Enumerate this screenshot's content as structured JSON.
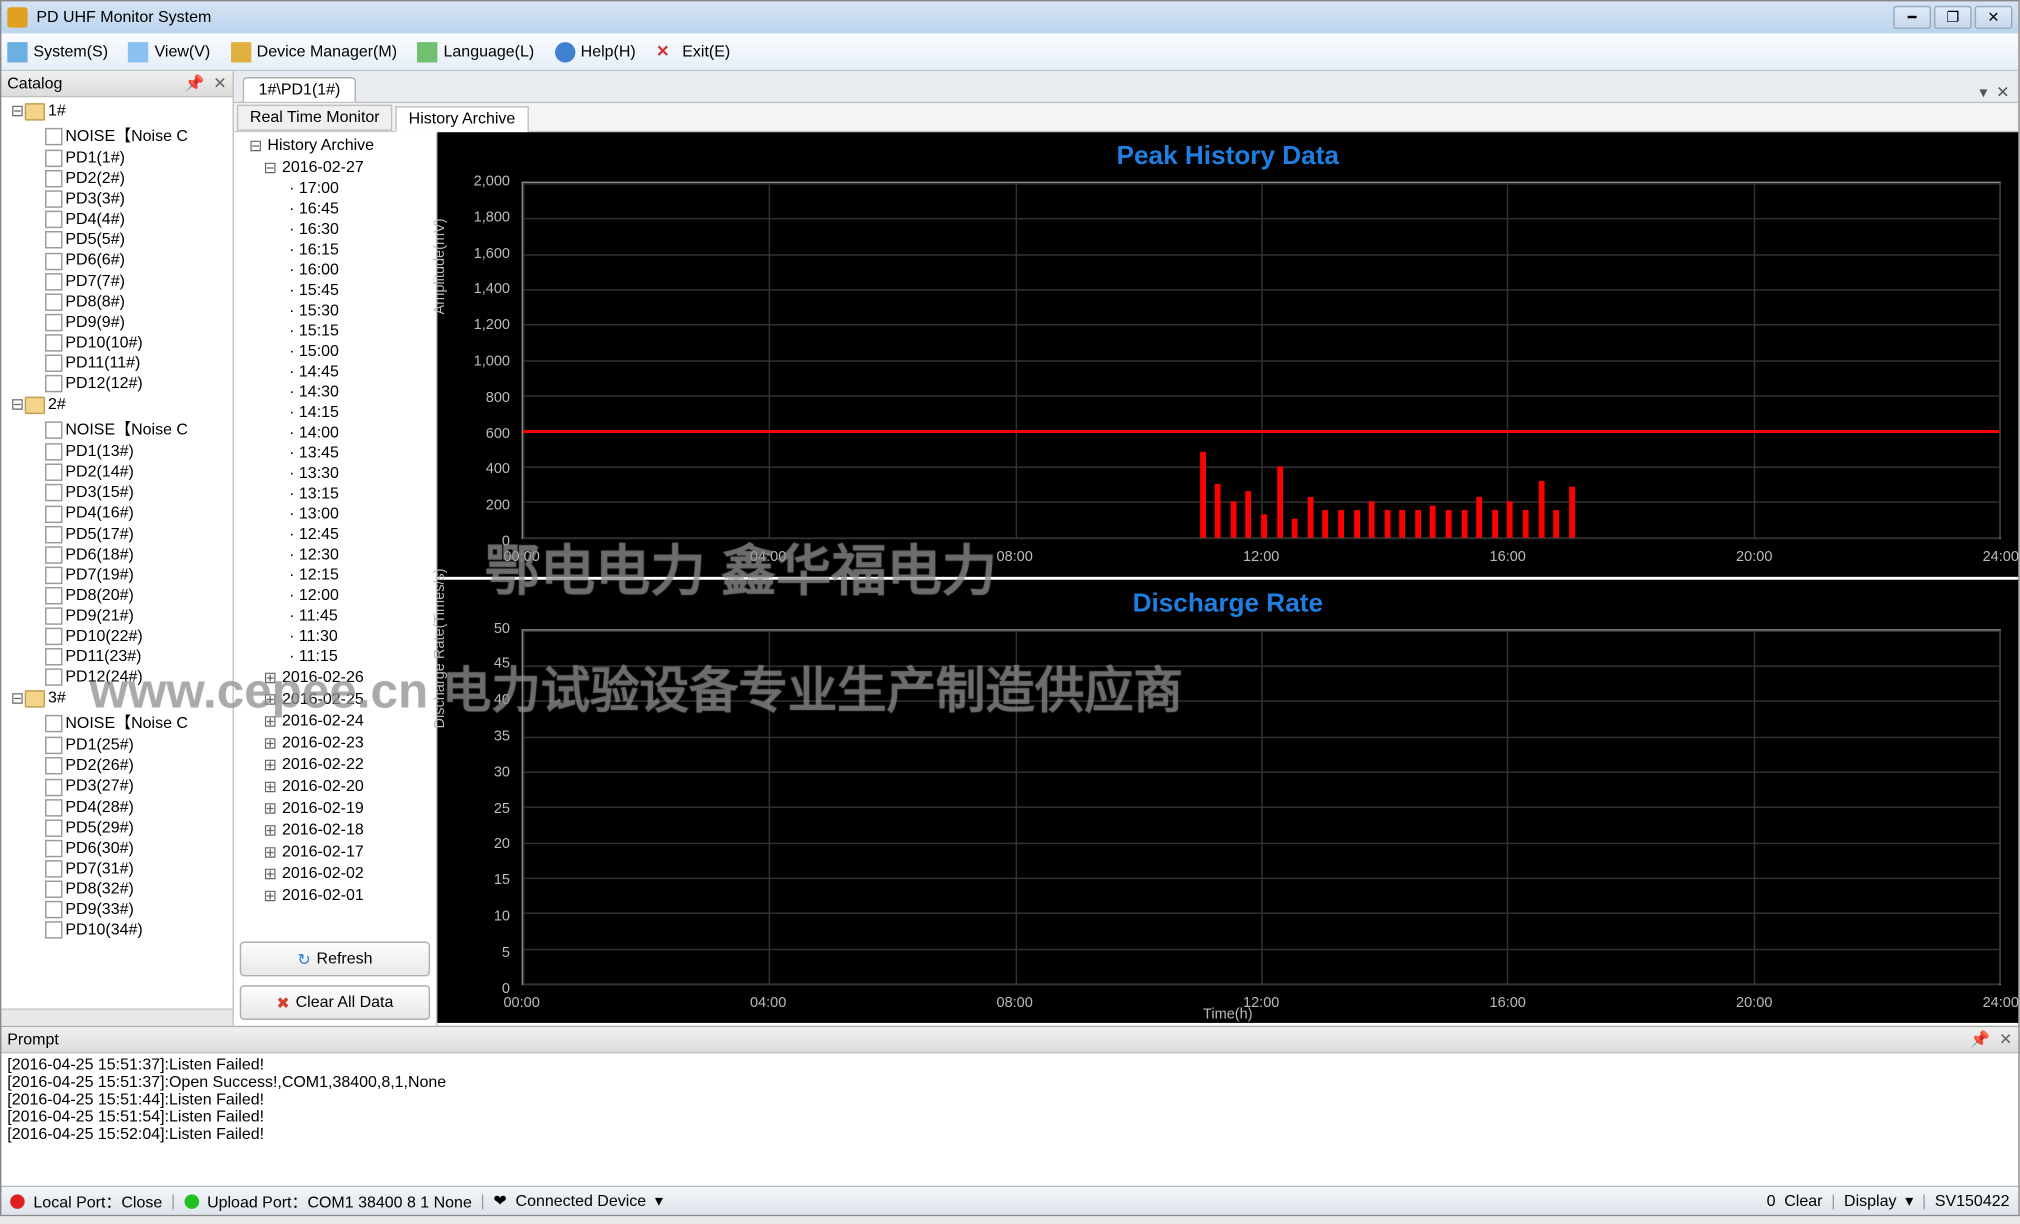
{
  "window": {
    "title": "PD UHF Monitor System"
  },
  "menu": {
    "system": "System(S)",
    "view": "View(V)",
    "device": "Device Manager(M)",
    "language": "Language(L)",
    "help": "Help(H)",
    "exit": "Exit(E)"
  },
  "catalog": {
    "title": "Catalog",
    "groups": [
      {
        "label": "1#",
        "items": [
          "NOISE【Noise C",
          "PD1(1#)",
          "PD2(2#)",
          "PD3(3#)",
          "PD4(4#)",
          "PD5(5#)",
          "PD6(6#)",
          "PD7(7#)",
          "PD8(8#)",
          "PD9(9#)",
          "PD10(10#)",
          "PD11(11#)",
          "PD12(12#)"
        ]
      },
      {
        "label": "2#",
        "items": [
          "NOISE【Noise C",
          "PD1(13#)",
          "PD2(14#)",
          "PD3(15#)",
          "PD4(16#)",
          "PD5(17#)",
          "PD6(18#)",
          "PD7(19#)",
          "PD8(20#)",
          "PD9(21#)",
          "PD10(22#)",
          "PD11(23#)",
          "PD12(24#)"
        ]
      },
      {
        "label": "3#",
        "items": [
          "NOISE【Noise C",
          "PD1(25#)",
          "PD2(26#)",
          "PD3(27#)",
          "PD4(28#)",
          "PD5(29#)",
          "PD6(30#)",
          "PD7(31#)",
          "PD8(32#)",
          "PD9(33#)",
          "PD10(34#)"
        ]
      }
    ]
  },
  "tabs": {
    "main": "1#\\PD1(1#)",
    "sub": [
      "Real Time Monitor",
      "History Archive"
    ]
  },
  "archive": {
    "root": "History Archive",
    "expanded_date": "2016-02-27",
    "times": [
      "17:00",
      "16:45",
      "16:30",
      "16:15",
      "16:00",
      "15:45",
      "15:30",
      "15:15",
      "15:00",
      "14:45",
      "14:30",
      "14:15",
      "14:00",
      "13:45",
      "13:30",
      "13:15",
      "13:00",
      "12:45",
      "12:30",
      "12:15",
      "12:00",
      "11:45",
      "11:30",
      "11:15"
    ],
    "dates": [
      "2016-02-26",
      "2016-02-25",
      "2016-02-24",
      "2016-02-23",
      "2016-02-22",
      "2016-02-20",
      "2016-02-19",
      "2016-02-18",
      "2016-02-17",
      "2016-02-02",
      "2016-02-01"
    ],
    "refresh": "Refresh",
    "clear": "Clear All Data"
  },
  "chart_data": [
    {
      "type": "bar",
      "title": "Peak History Data",
      "ylabel": "Amplitude(mV)",
      "xlabel": "",
      "ylim": [
        0,
        2000
      ],
      "yticks": [
        0,
        200,
        400,
        600,
        800,
        1000,
        1200,
        1400,
        1600,
        1800,
        2000
      ],
      "xlim": [
        0,
        24
      ],
      "xticks": [
        "00:00",
        "04:00",
        "08:00",
        "12:00",
        "16:00",
        "20:00",
        "24:00"
      ],
      "threshold": 600,
      "series": [
        {
          "name": "Amplitude",
          "x": [
            11.0,
            11.25,
            11.5,
            11.75,
            12.0,
            12.25,
            12.5,
            12.75,
            13.0,
            13.25,
            13.5,
            13.75,
            14.0,
            14.25,
            14.5,
            14.75,
            15.0,
            15.25,
            15.5,
            15.75,
            16.0,
            16.25,
            16.5,
            16.75,
            17.0
          ],
          "values": [
            480,
            300,
            200,
            260,
            130,
            400,
            100,
            230,
            150,
            150,
            150,
            200,
            150,
            150,
            150,
            180,
            150,
            150,
            230,
            150,
            200,
            150,
            320,
            150,
            280
          ]
        }
      ]
    },
    {
      "type": "bar",
      "title": "Discharge Rate",
      "ylabel": "Discharge Rate(Times/s)",
      "xlabel": "Time(h)",
      "ylim": [
        0,
        50
      ],
      "yticks": [
        0,
        5,
        10,
        15,
        20,
        25,
        30,
        35,
        40,
        45,
        50
      ],
      "xlim": [
        0,
        24
      ],
      "xticks": [
        "00:00",
        "04:00",
        "08:00",
        "12:00",
        "16:00",
        "20:00",
        "24:00"
      ],
      "series": [
        {
          "name": "Rate",
          "x": [],
          "values": []
        }
      ]
    }
  ],
  "watermark": {
    "line1": "鄂电电力 鑫华福电力",
    "line2": "www.cepee.cn 电力试验设备专业生产制造供应商"
  },
  "prompt": {
    "title": "Prompt",
    "lines": [
      "[2016-04-25 15:51:37]:Listen Failed!",
      "[2016-04-25 15:51:37]:Open Success!,COM1,38400,8,1,None",
      "[2016-04-25 15:51:44]:Listen Failed!",
      "[2016-04-25 15:51:54]:Listen Failed!",
      "[2016-04-25 15:52:04]:Listen Failed!"
    ]
  },
  "status": {
    "local": "Local Port：Close",
    "upload": "Upload Port：COM1 38400 8 1 None",
    "connected": "Connected Device",
    "clear": "Clear",
    "display": "Display",
    "count": "0",
    "version": "SV150422"
  }
}
